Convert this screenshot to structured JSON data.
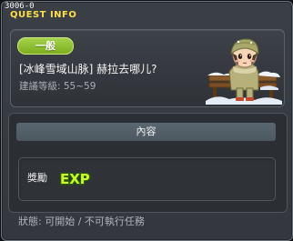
{
  "window": {
    "quest_id": "3006-0",
    "title": "QUEST INFO"
  },
  "quest": {
    "category_badge": "一般",
    "name": "[冰峰雪域山脉] 赫拉去哪儿?",
    "level_range": "建議等級: 55~59",
    "npc_icon": "npc-snow-girl-on-bench"
  },
  "content": {
    "header": "內容",
    "reward_label": "獎勵",
    "reward_icon": "exp-icon",
    "reward_text": "EXP"
  },
  "status": "狀態: 可開始 / 不可執行任務",
  "colors": {
    "title": "#ffde4a",
    "badge": "#8dbf2e",
    "exp": "#c8ff2a"
  }
}
